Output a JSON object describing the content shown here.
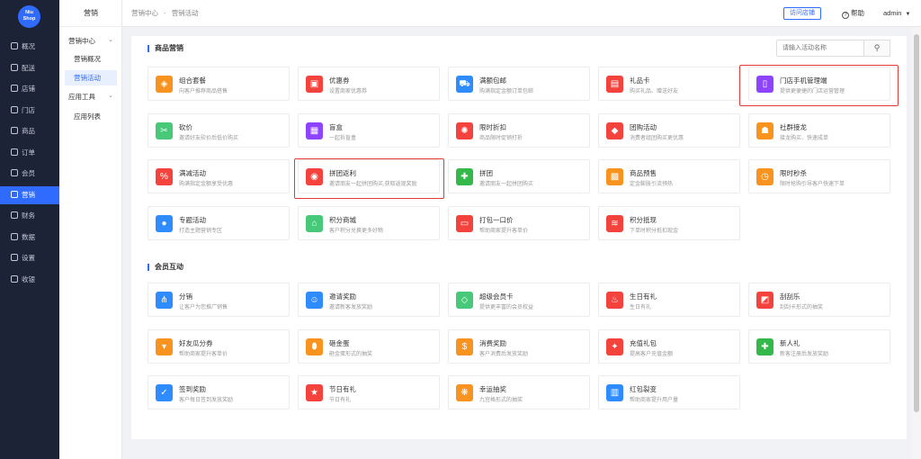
{
  "logo": {
    "line1": "Niu",
    "line2": "Shop"
  },
  "nav": [
    {
      "label": "概况",
      "icon": "dashboard-icon"
    },
    {
      "label": "配送",
      "icon": "delivery-icon"
    },
    {
      "label": "店铺",
      "icon": "shop-icon"
    },
    {
      "label": "门店",
      "icon": "store-icon"
    },
    {
      "label": "商品",
      "icon": "goods-icon"
    },
    {
      "label": "订单",
      "icon": "order-icon"
    },
    {
      "label": "会员",
      "icon": "member-icon"
    },
    {
      "label": "营销",
      "icon": "marketing-icon",
      "active": true
    },
    {
      "label": "财务",
      "icon": "finance-icon"
    },
    {
      "label": "数据",
      "icon": "data-icon"
    },
    {
      "label": "设置",
      "icon": "settings-icon"
    },
    {
      "label": "收银",
      "icon": "cashier-icon"
    }
  ],
  "sub": {
    "title": "营销",
    "group1": "营销中心",
    "item1": "营销概况",
    "item2": "营销活动",
    "group2": "应用工具",
    "item3": "应用列表"
  },
  "header": {
    "crumb1": "营销中心",
    "sep": "-",
    "crumb2": "营销活动",
    "visit": "访问店铺",
    "help": "帮助",
    "user": "admin"
  },
  "search": {
    "placeholder": "请输入活动名称"
  },
  "sections": {
    "s1": "商品营销",
    "s2": "会员互动"
  },
  "tiles1": [
    {
      "name": "组合套餐",
      "desc": "向客户推荐商品搭售",
      "color": "#f7931e",
      "icon": "layers-icon",
      "glyph": "◈"
    },
    {
      "name": "优惠券",
      "desc": "设置商家优惠券",
      "color": "#f4433c",
      "icon": "coupon-icon",
      "glyph": "▣"
    },
    {
      "name": "满额包邮",
      "desc": "购满指定金额订单包邮",
      "color": "#2f8cff",
      "icon": "truck-icon",
      "glyph": "⛟"
    },
    {
      "name": "礼品卡",
      "desc": "购买礼品、赠送好友",
      "color": "#f4433c",
      "icon": "giftcard-icon",
      "glyph": "▤"
    },
    {
      "name": "门店手机管理端",
      "desc": "提供更便捷的门店运营管理",
      "color": "#8e44ff",
      "icon": "phone-icon",
      "glyph": "▯"
    },
    {
      "name": "砍价",
      "desc": "邀请好友砍价后低价购买",
      "color": "#47c979",
      "icon": "bargain-icon",
      "glyph": "✂"
    },
    {
      "name": "盲盒",
      "desc": "一起拆盲盒",
      "color": "#8e44ff",
      "icon": "blindbox-icon",
      "glyph": "▦"
    },
    {
      "name": "限时折扣",
      "desc": "商品限时促销打折",
      "color": "#f4433c",
      "icon": "discount-icon",
      "glyph": "✺"
    },
    {
      "name": "团购活动",
      "desc": "消费者组团购买更优惠",
      "color": "#f4433c",
      "icon": "tag-icon",
      "glyph": "◆"
    },
    {
      "name": "社群接龙",
      "desc": "接龙购买、快速成单",
      "color": "#f7931e",
      "icon": "group-icon",
      "glyph": "☗"
    },
    {
      "name": "满减活动",
      "desc": "购满指定金额享受优惠",
      "color": "#f4433c",
      "icon": "percent-icon",
      "glyph": "%"
    },
    {
      "name": "拼团返利",
      "desc": "邀请朋友一起拼团购买,获取返现奖励",
      "color": "#f4433c",
      "icon": "rebate-icon",
      "glyph": "◉"
    },
    {
      "name": "拼团",
      "desc": "邀请朋友一起拼团购买",
      "color": "#35b84a",
      "icon": "puzzle-icon",
      "glyph": "✚"
    },
    {
      "name": "商品预售",
      "desc": "定金膨胀引流预热",
      "color": "#f7931e",
      "icon": "presale-icon",
      "glyph": "▩"
    },
    {
      "name": "限时秒杀",
      "desc": "限时抢购引导客户快速下单",
      "color": "#f7931e",
      "icon": "clock-icon",
      "glyph": "◷"
    },
    {
      "name": "专题活动",
      "desc": "打造主题营销专区",
      "color": "#2f8cff",
      "icon": "topic-icon",
      "glyph": "●"
    },
    {
      "name": "积分商城",
      "desc": "客户积分兑换更多好物",
      "color": "#47c979",
      "icon": "mall-icon",
      "glyph": "⌂"
    },
    {
      "name": "打包一口价",
      "desc": "帮助商家提升客单价",
      "color": "#f4433c",
      "icon": "package-icon",
      "glyph": "▭"
    },
    {
      "name": "积分抵现",
      "desc": "下单时积分抵扣现金",
      "color": "#f4433c",
      "icon": "coins-icon",
      "glyph": "≋"
    }
  ],
  "tiles2": [
    {
      "name": "分销",
      "desc": "让客户为您推广销售",
      "color": "#2f8cff",
      "icon": "distribute-icon",
      "glyph": "⋔"
    },
    {
      "name": "邀请奖励",
      "desc": "邀请新客发放奖励",
      "color": "#2f8cff",
      "icon": "invite-icon",
      "glyph": "☺"
    },
    {
      "name": "超级会员卡",
      "desc": "提供更丰富的会员权益",
      "color": "#47c979",
      "icon": "diamond-icon",
      "glyph": "◇"
    },
    {
      "name": "生日有礼",
      "desc": "生日有礼",
      "color": "#f4433c",
      "icon": "cake-icon",
      "glyph": "♨"
    },
    {
      "name": "刮刮乐",
      "desc": "刮刮卡形式的抽奖",
      "color": "#f4433c",
      "icon": "scratch-icon",
      "glyph": "◩"
    },
    {
      "name": "好友瓜分券",
      "desc": "帮助商家提升客单价",
      "color": "#f7931e",
      "icon": "share-coupon-icon",
      "glyph": "▾"
    },
    {
      "name": "砸金蛋",
      "desc": "砸金蛋形式的抽奖",
      "color": "#f7931e",
      "icon": "egg-icon",
      "glyph": "⬮"
    },
    {
      "name": "消费奖励",
      "desc": "客户消费后发放奖励",
      "color": "#f7931e",
      "icon": "moneybag-icon",
      "glyph": "$"
    },
    {
      "name": "充值礼包",
      "desc": "提高客户充值金额",
      "color": "#f4433c",
      "icon": "recharge-icon",
      "glyph": "✦"
    },
    {
      "name": "新人礼",
      "desc": "新客注册后发放奖励",
      "color": "#35b84a",
      "icon": "newuser-icon",
      "glyph": "✚"
    },
    {
      "name": "签到奖励",
      "desc": "客户每日签到发放奖励",
      "color": "#2f8cff",
      "icon": "checkin-icon",
      "glyph": "✓"
    },
    {
      "name": "节日有礼",
      "desc": "节日有礼",
      "color": "#f4433c",
      "icon": "star-icon",
      "glyph": "★"
    },
    {
      "name": "幸运抽奖",
      "desc": "九宫格形式的抽奖",
      "color": "#f7931e",
      "icon": "lottery-icon",
      "glyph": "❋"
    },
    {
      "name": "红包裂变",
      "desc": "帮助商家提升用户量",
      "color": "#2f8cff",
      "icon": "redpacket-icon",
      "glyph": "▥"
    }
  ]
}
